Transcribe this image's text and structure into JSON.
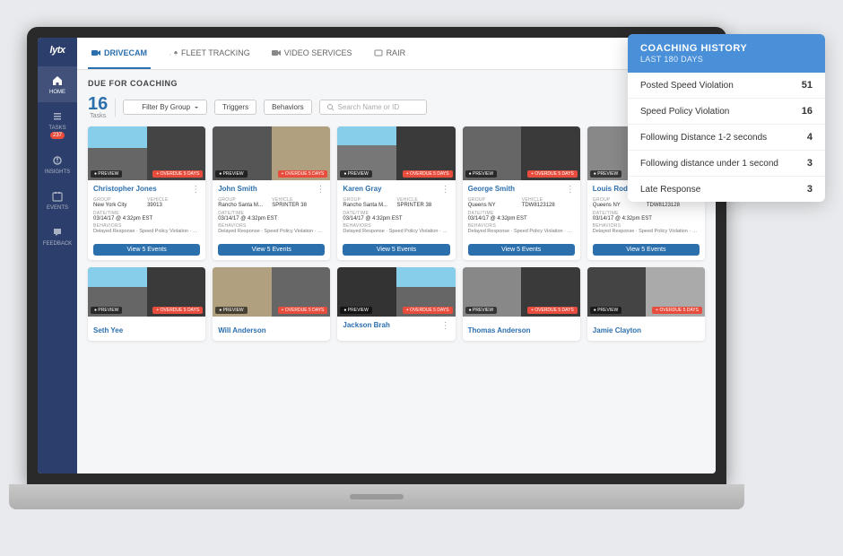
{
  "app": {
    "logo": "lytx"
  },
  "sidebar": {
    "items": [
      {
        "id": "home",
        "label": "HOME",
        "active": true
      },
      {
        "id": "tasks",
        "label": "TASKS",
        "badge": "237"
      },
      {
        "id": "insights",
        "label": "INSIGHTS"
      },
      {
        "id": "events",
        "label": "EVENTS"
      },
      {
        "id": "feedback",
        "label": "FEEDBACK"
      }
    ]
  },
  "nav": {
    "tabs": [
      {
        "id": "drivecam",
        "label": "DRIVECAM",
        "active": true
      },
      {
        "id": "fleet",
        "label": "FLEET TRACKING"
      },
      {
        "id": "video",
        "label": "VIDEO SERVICES"
      },
      {
        "id": "rair",
        "label": "RAIR"
      }
    ]
  },
  "content": {
    "section_title": "DUE FOR COACHING",
    "tasks_count": "16",
    "tasks_label": "Tasks",
    "filters": {
      "group": "Filter By Group",
      "triggers": "Triggers",
      "behaviors": "Behaviors",
      "search": "Search Name or ID"
    },
    "cards_row1": [
      {
        "name": "Christopher Jones",
        "group": "New York City",
        "vehicle": "39013",
        "date_time": "03/14/17 @ 4:32pm EST",
        "behaviors": "Delayed Response · Speed Policy Violation · Unsafe Lane Change ·",
        "btn": "View 5 Events",
        "img_left": "road",
        "img_right": "interior"
      },
      {
        "name": "John Smith",
        "group": "Rancho Santa M...",
        "vehicle": "SPRINTER 38",
        "date_time": "03/14/17 @ 4:32pm EST",
        "behaviors": "Delayed Response · Speed Policy Violation · Unsafe Lane Change ·",
        "btn": "View 5 Events",
        "img_left": "interior",
        "img_right": "bright"
      },
      {
        "name": "Karen Gray",
        "group": "Rancho Santa M...",
        "vehicle": "SPRINTER 38",
        "date_time": "03/14/17 @ 4:32pm EST",
        "behaviors": "Delayed Response · Speed Policy Violation · Unsafe Lane Change ·",
        "btn": "View 5 Events",
        "img_left": "road",
        "img_right": "interior"
      },
      {
        "name": "George Smith",
        "group": "Queens NY",
        "vehicle": "TDW8123128",
        "date_time": "03/14/17 @ 4:32pm EST",
        "behaviors": "Delayed Response · Speed Policy Violation · Unsafe Lane Change ·",
        "btn": "View 5 Events",
        "img_left": "gray_dark",
        "img_right": "interior"
      },
      {
        "name": "Louis Rodriguez",
        "group": "Queens NY",
        "vehicle": "TDW8123128",
        "date_time": "03/14/17 @ 4:32pm EST",
        "behaviors": "Delayed Response · Speed Policy Violation · Unsafe Lane Change ·",
        "btn": "View 5 Events",
        "img_left": "gray_med",
        "img_right": "dark"
      }
    ],
    "cards_row2": [
      {
        "name": "Seth Yee",
        "img_left": "road",
        "img_right": "interior"
      },
      {
        "name": "Will Anderson",
        "img_left": "bright",
        "img_right": "gray_dark"
      },
      {
        "name": "Jackson Brah",
        "img_left": "interior",
        "img_right": "road"
      },
      {
        "name": "Thomas Anderson",
        "img_left": "gray_med",
        "img_right": "interior"
      },
      {
        "name": "Jamie Clayton",
        "img_left": "dark",
        "img_right": "gray_light"
      }
    ]
  },
  "coaching_popup": {
    "title": "COACHING HISTORY",
    "subtitle": "LAST 180 DAYS",
    "rows": [
      {
        "label": "Posted Speed Violation",
        "value": "51"
      },
      {
        "label": "Speed Policy Violation",
        "value": "16"
      },
      {
        "label": "Following Distance 1-2 seconds",
        "value": "4"
      },
      {
        "label": "Following distance under 1 second",
        "value": "3"
      },
      {
        "label": "Late Response",
        "value": "3"
      }
    ]
  },
  "labels": {
    "preview": "● PREVIEW",
    "overdue": "+ OVERDUE 5 DAYS",
    "group": "GROUP",
    "vehicle": "VEHICLE",
    "date_time": "DATE/TIME",
    "behaviors": "BEHAVIORS"
  }
}
